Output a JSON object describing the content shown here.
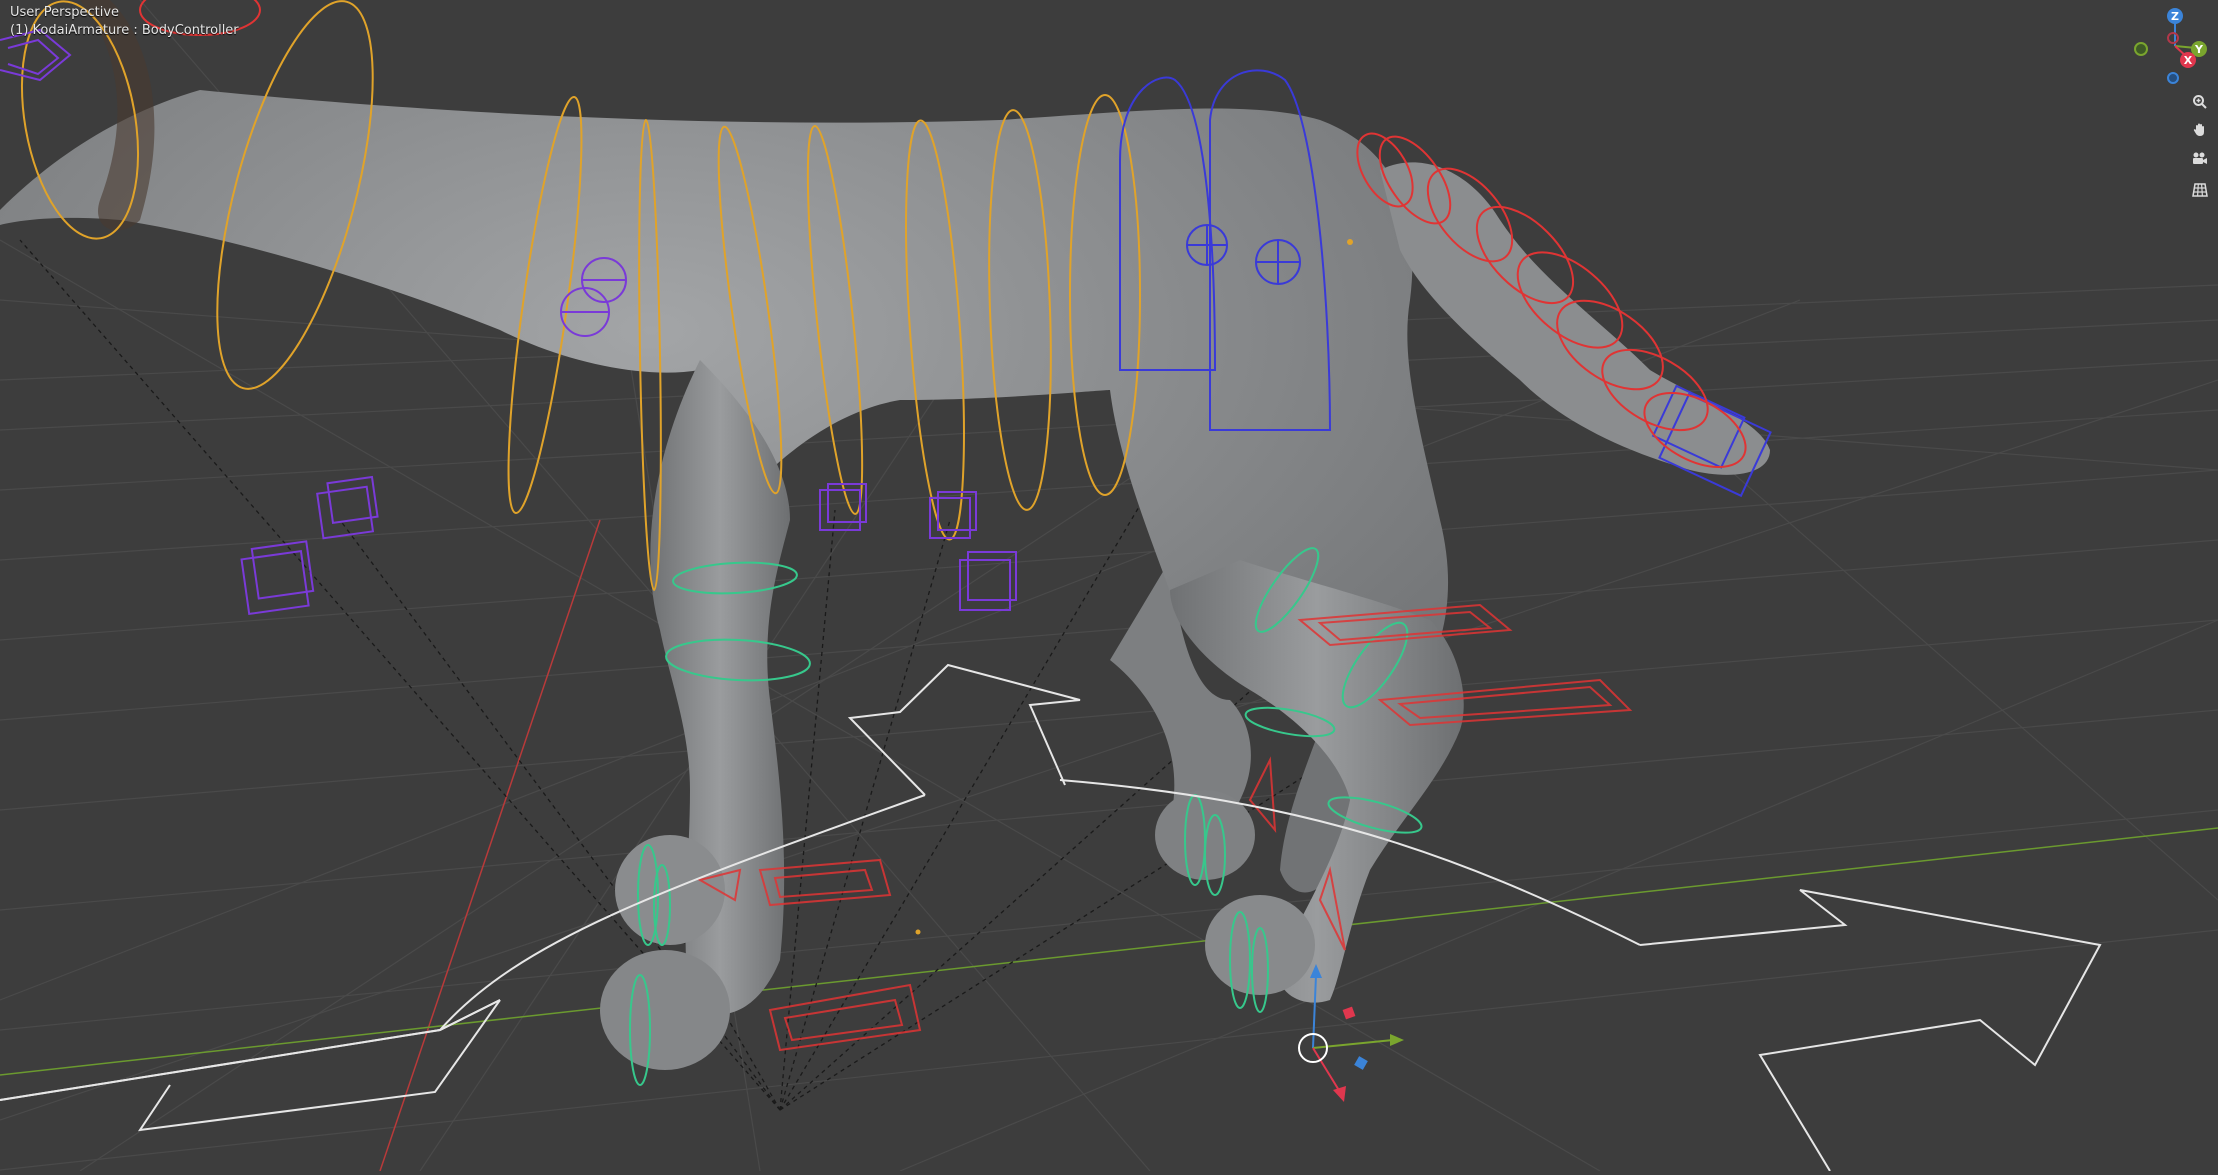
{
  "viewport": {
    "title": "User Perspective",
    "active_object": "(1) KodaiArmature : BodyController"
  },
  "axis_gizmo": {
    "z_label": "Z",
    "y_label": "Y",
    "x_label": "X",
    "colors": {
      "x": "#e0374e",
      "y": "#7aa52e",
      "z": "#3b84d9"
    }
  },
  "nav_tools": [
    {
      "name": "zoom-icon",
      "glyph": "🔍"
    },
    {
      "name": "hand-pan-icon",
      "glyph": "✋"
    },
    {
      "name": "camera-view-icon",
      "glyph": "🎥"
    },
    {
      "name": "ortho-grid-icon",
      "glyph": "▦"
    }
  ],
  "colors": {
    "background": "#3d3d3d",
    "grid": "#4a4a4a",
    "axis_x_line": "#b83a3a",
    "axis_y_line": "#6b9a2f",
    "mesh": "#8c8e90",
    "bone_orange": "#e0a32a",
    "bone_blue": "#3a3ad8",
    "bone_red": "#e03434",
    "bone_purple": "#7a3ad8",
    "bone_green": "#37c88c",
    "root_white": "#e6e6e6"
  }
}
